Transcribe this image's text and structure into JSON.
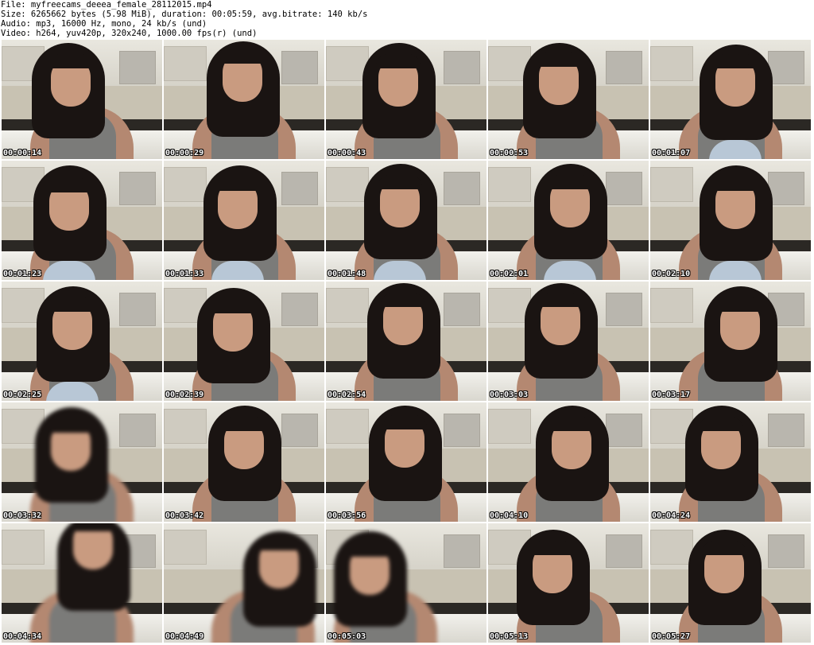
{
  "header": {
    "file_line": "File: myfreecams_deeea_female_28112015.mp4",
    "size_line": "Size: 6265662 bytes (5.98 MiB), duration: 00:05:59, avg.bitrate: 140 kb/s",
    "audio_line": "Audio: mp3, 16000 Hz, mono, 24 kb/s (und)",
    "video_line": "Video: h264, yuv420p, 320x240, 1000.00 fps(r) (und)"
  },
  "thumbnails": [
    {
      "timestamp": "00:00:14"
    },
    {
      "timestamp": "00:00:29"
    },
    {
      "timestamp": "00:00:43"
    },
    {
      "timestamp": "00:00:53"
    },
    {
      "timestamp": "00:01:07"
    },
    {
      "timestamp": "00:01:23"
    },
    {
      "timestamp": "00:01:33"
    },
    {
      "timestamp": "00:01:48"
    },
    {
      "timestamp": "00:02:01"
    },
    {
      "timestamp": "00:02:10"
    },
    {
      "timestamp": "00:02:25"
    },
    {
      "timestamp": "00:02:39"
    },
    {
      "timestamp": "00:02:54"
    },
    {
      "timestamp": "00:03:03"
    },
    {
      "timestamp": "00:03:17"
    },
    {
      "timestamp": "00:03:32"
    },
    {
      "timestamp": "00:03:42"
    },
    {
      "timestamp": "00:03:56"
    },
    {
      "timestamp": "00:04:10"
    },
    {
      "timestamp": "00:04:24"
    },
    {
      "timestamp": "00:04:34"
    },
    {
      "timestamp": "00:04:49"
    },
    {
      "timestamp": "00:05:03"
    },
    {
      "timestamp": "00:05:13"
    },
    {
      "timestamp": "00:05:27"
    }
  ]
}
